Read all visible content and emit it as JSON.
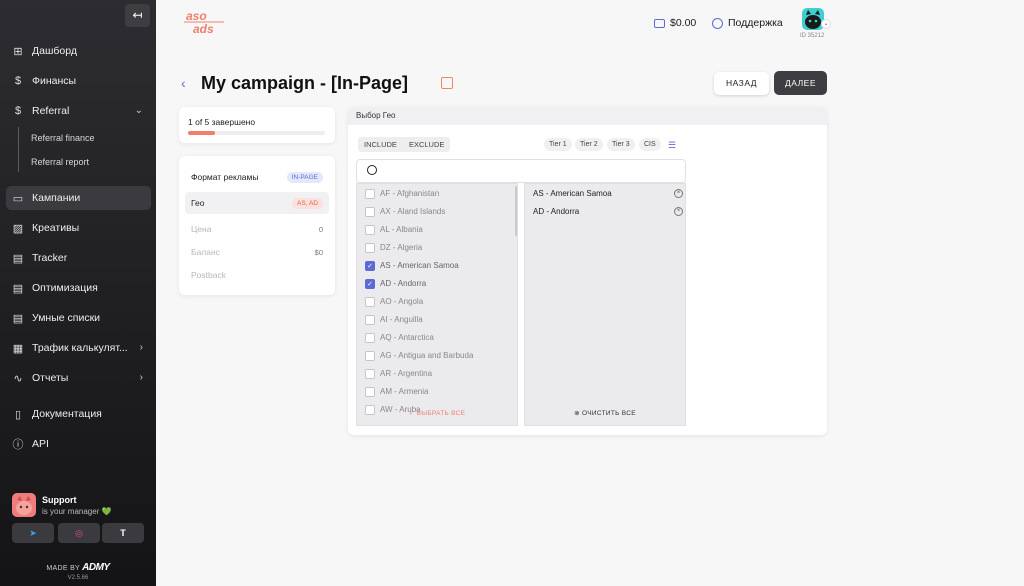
{
  "sidebar": {
    "collapse_icon": "↤",
    "items": [
      {
        "label": "Дашборд",
        "icon": "grid-icon",
        "glyph": "⊞"
      },
      {
        "label": "Финансы",
        "icon": "dollar-icon",
        "glyph": "$"
      },
      {
        "label": "Referral",
        "icon": "dollar-icon",
        "glyph": "$",
        "arrow": "⌄"
      },
      {
        "label": "Кампании",
        "icon": "monitor-icon",
        "glyph": "▭"
      },
      {
        "label": "Креативы",
        "icon": "image-icon",
        "glyph": "▨"
      },
      {
        "label": "Tracker",
        "icon": "file-icon",
        "glyph": "▤"
      },
      {
        "label": "Оптимизация",
        "icon": "file-icon",
        "glyph": "▤"
      },
      {
        "label": "Умные списки",
        "icon": "file-icon",
        "glyph": "▤"
      },
      {
        "label": "Трафик калькулят...",
        "icon": "calculator-icon",
        "glyph": "▦",
        "arrow": "›"
      },
      {
        "label": "Отчеты",
        "icon": "activity-icon",
        "glyph": "∿",
        "arrow": "›"
      },
      {
        "label": "Документация",
        "icon": "book-icon",
        "glyph": "▯"
      },
      {
        "label": "API",
        "icon": "info-icon",
        "glyph": "ⓘ"
      }
    ],
    "sub_items": [
      "Referral finance",
      "Referral report"
    ],
    "support": {
      "title": "Support",
      "subtitle": "is your manager 💚"
    },
    "socials": [
      "telegram-icon",
      "instagram-icon",
      "tiktok-icon"
    ],
    "made_by": "MADE BY",
    "brand": "ADMY",
    "version": "V2.5.66"
  },
  "header": {
    "logo_top": "aso",
    "logo_bottom": "ads",
    "balance": "$0.00",
    "support": "Поддержка",
    "user_id": "ID 35212"
  },
  "page": {
    "title": "My campaign - [In-Page]",
    "back_label": "НАЗАД",
    "next_label": "ДАЛЕЕ"
  },
  "progress": {
    "text": "1 of 5 завершено",
    "fraction": 0.2
  },
  "summary": {
    "rows": [
      {
        "label": "Формат рекламы",
        "value": "IN-PAGE"
      },
      {
        "label": "Гео",
        "value": "AS, AD"
      },
      {
        "label": "Цена",
        "value": "0"
      },
      {
        "label": "Баланс",
        "value": "$0"
      },
      {
        "label": "Postback",
        "value": ""
      }
    ]
  },
  "geo": {
    "header": "Выбор Гео",
    "include_label": "INCLUDE",
    "exclude_label": "EXCLUDE",
    "tiers": [
      "Tier 1",
      "Tier 2",
      "Tier 3",
      "CIS"
    ],
    "search_value": "",
    "countries": [
      {
        "label": "AF - Afghanistan",
        "checked": false
      },
      {
        "label": "AX - Aland Islands",
        "checked": false
      },
      {
        "label": "AL - Albania",
        "checked": false
      },
      {
        "label": "DZ - Algeria",
        "checked": false
      },
      {
        "label": "AS - American Samoa",
        "checked": true
      },
      {
        "label": "AD - Andorra",
        "checked": true
      },
      {
        "label": "AO - Angola",
        "checked": false
      },
      {
        "label": "AI - Anguilla",
        "checked": false
      },
      {
        "label": "AQ - Antarctica",
        "checked": false
      },
      {
        "label": "AG - Antigua and Barbuda",
        "checked": false
      },
      {
        "label": "AR - Argentina",
        "checked": false
      },
      {
        "label": "AM - Armenia",
        "checked": false
      },
      {
        "label": "AW - Aruba",
        "checked": false
      }
    ],
    "selected": [
      "AS - American Samoa",
      "AD - Andorra"
    ],
    "select_all_label": "ВЫБРАТЬ ВСЕ",
    "clear_all_label": "ОЧИСТИТЬ ВСЕ"
  },
  "colors": {
    "accent": "#5b6bd6",
    "brand": "#ef7f6c",
    "dark_button": "#3d3d42"
  }
}
